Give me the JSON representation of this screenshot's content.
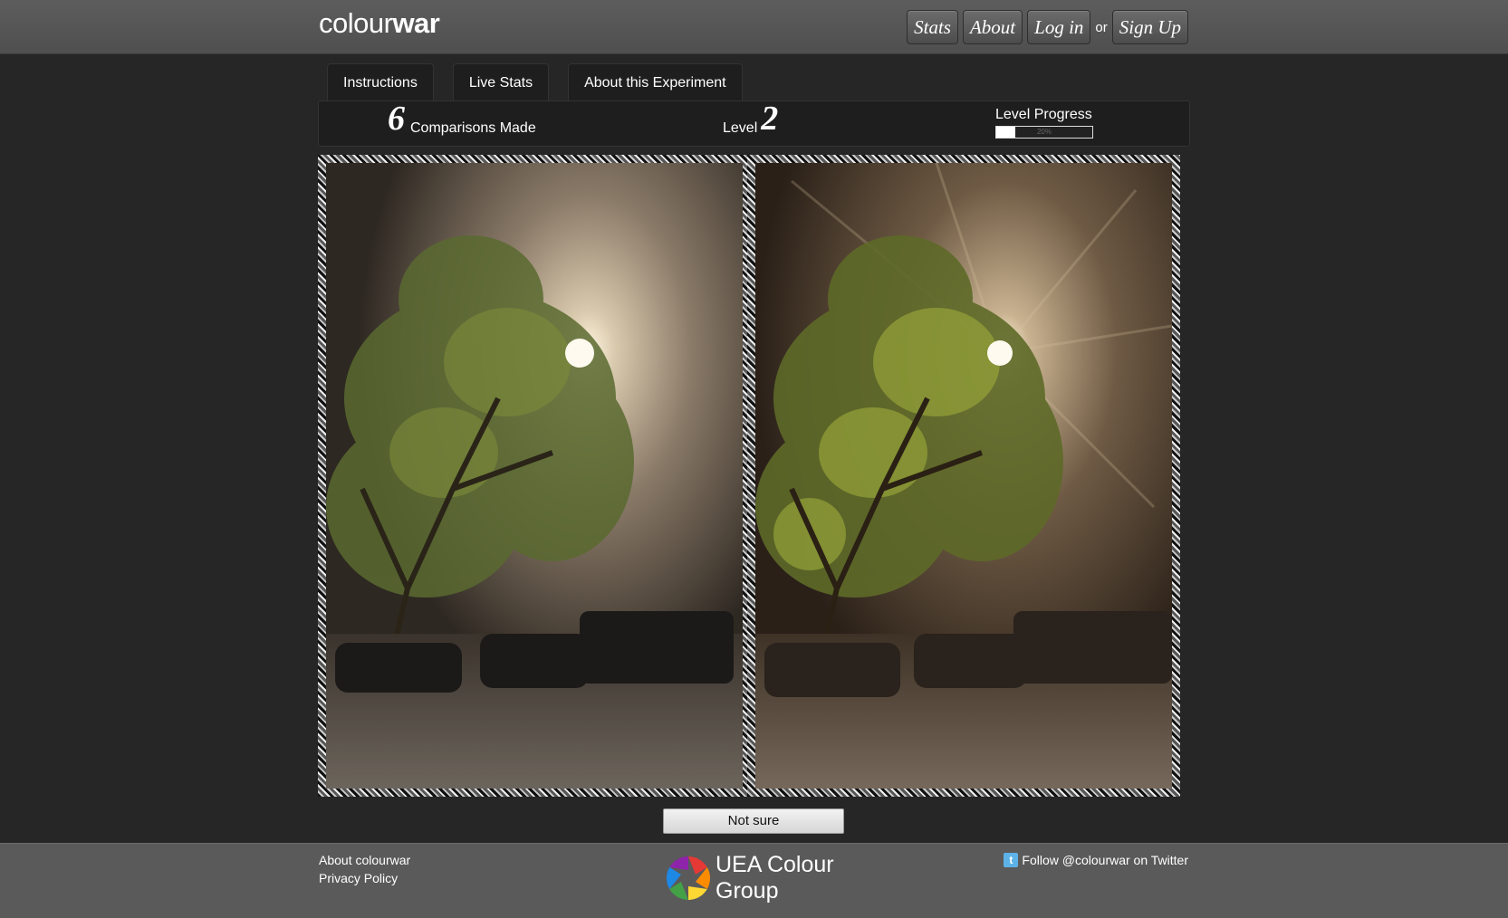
{
  "header": {
    "logo_light": "colour",
    "logo_bold": "war",
    "nav": {
      "stats": "Stats",
      "about": "About",
      "login": "Log in",
      "or": "or",
      "signup": "Sign Up"
    }
  },
  "tabs": {
    "instructions": "Instructions",
    "live_stats": "Live Stats",
    "about_experiment": "About this Experiment"
  },
  "stats": {
    "comparisons_count": "6",
    "comparisons_label": "Comparisons Made",
    "level_label": "Level",
    "level_value": "2",
    "progress_label": "Level Progress",
    "progress_percent": 20,
    "progress_text": "20%"
  },
  "buttons": {
    "not_sure": "Not sure"
  },
  "footer": {
    "about_link": "About colourwar",
    "privacy_link": "Privacy Policy",
    "uea_line1": "UEA Colour",
    "uea_line2": "Group",
    "twitter": "Follow @colourwar on Twitter"
  }
}
